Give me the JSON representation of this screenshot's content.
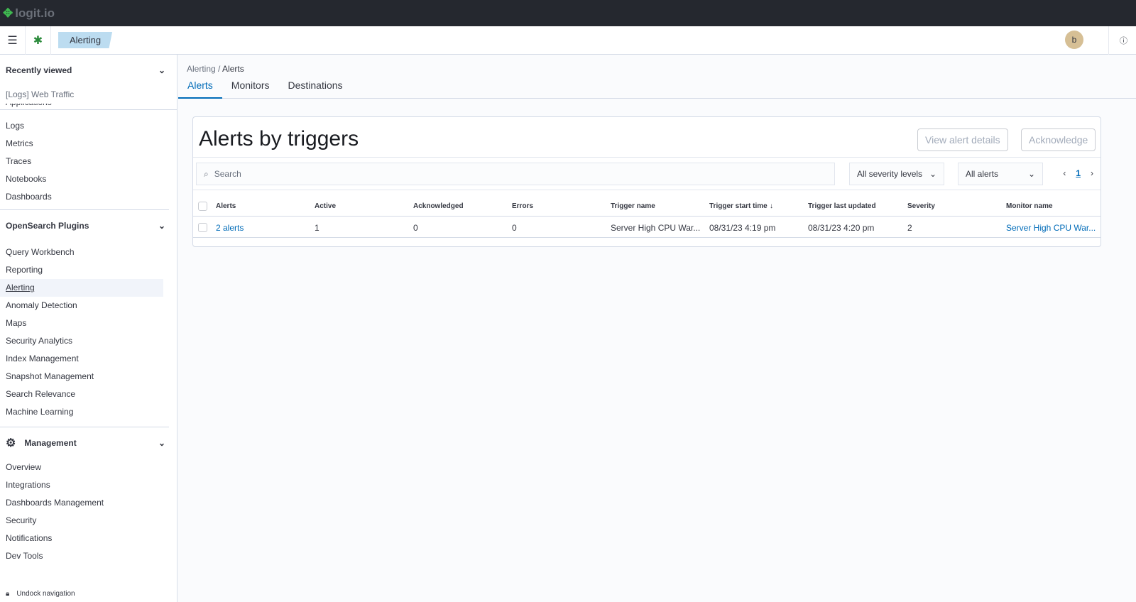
{
  "brand": "logit.io",
  "header": {
    "breadcrumb": "Alerting",
    "avatar": "b",
    "help_icon": "help-icon"
  },
  "sidebar": {
    "recent_title": "Recently viewed",
    "recent_items": [
      "[Logs] Web Traffic"
    ],
    "partial_item": "Applications",
    "observability_items": [
      "Logs",
      "Metrics",
      "Traces",
      "Notebooks",
      "Dashboards"
    ],
    "plugins_title": "OpenSearch Plugins",
    "plugins_items": [
      "Query Workbench",
      "Reporting",
      "Alerting",
      "Anomaly Detection",
      "Maps",
      "Security Analytics",
      "Index Management",
      "Snapshot Management",
      "Search Relevance",
      "Machine Learning"
    ],
    "management_title": "Management",
    "management_items": [
      "Overview",
      "Integrations",
      "Dashboards Management",
      "Security",
      "Notifications",
      "Dev Tools"
    ],
    "undock": "Undock navigation"
  },
  "main": {
    "breadcrumbs": [
      "Alerting",
      "Alerts"
    ],
    "tabs": [
      "Alerts",
      "Monitors",
      "Destinations"
    ],
    "title": "Alerts by triggers",
    "view_details": "View alert details",
    "acknowledge": "Acknowledge",
    "search_placeholder": "Search",
    "severity_filter": "All severity levels",
    "alerts_filter": "All alerts",
    "page": "1",
    "columns": [
      "Alerts",
      "Active",
      "Acknowledged",
      "Errors",
      "Trigger name",
      "Trigger start time",
      "Trigger last updated",
      "Severity",
      "Monitor name"
    ],
    "rows": [
      [
        "2 alerts",
        "1",
        "0",
        "0",
        "Server High CPU War...",
        "08/31/23 4:19 pm",
        "08/31/23 4:20 pm",
        "2",
        "Server High CPU War..."
      ]
    ]
  },
  "colors": {
    "accent": "#006bb8",
    "topbar": "#25282f"
  }
}
